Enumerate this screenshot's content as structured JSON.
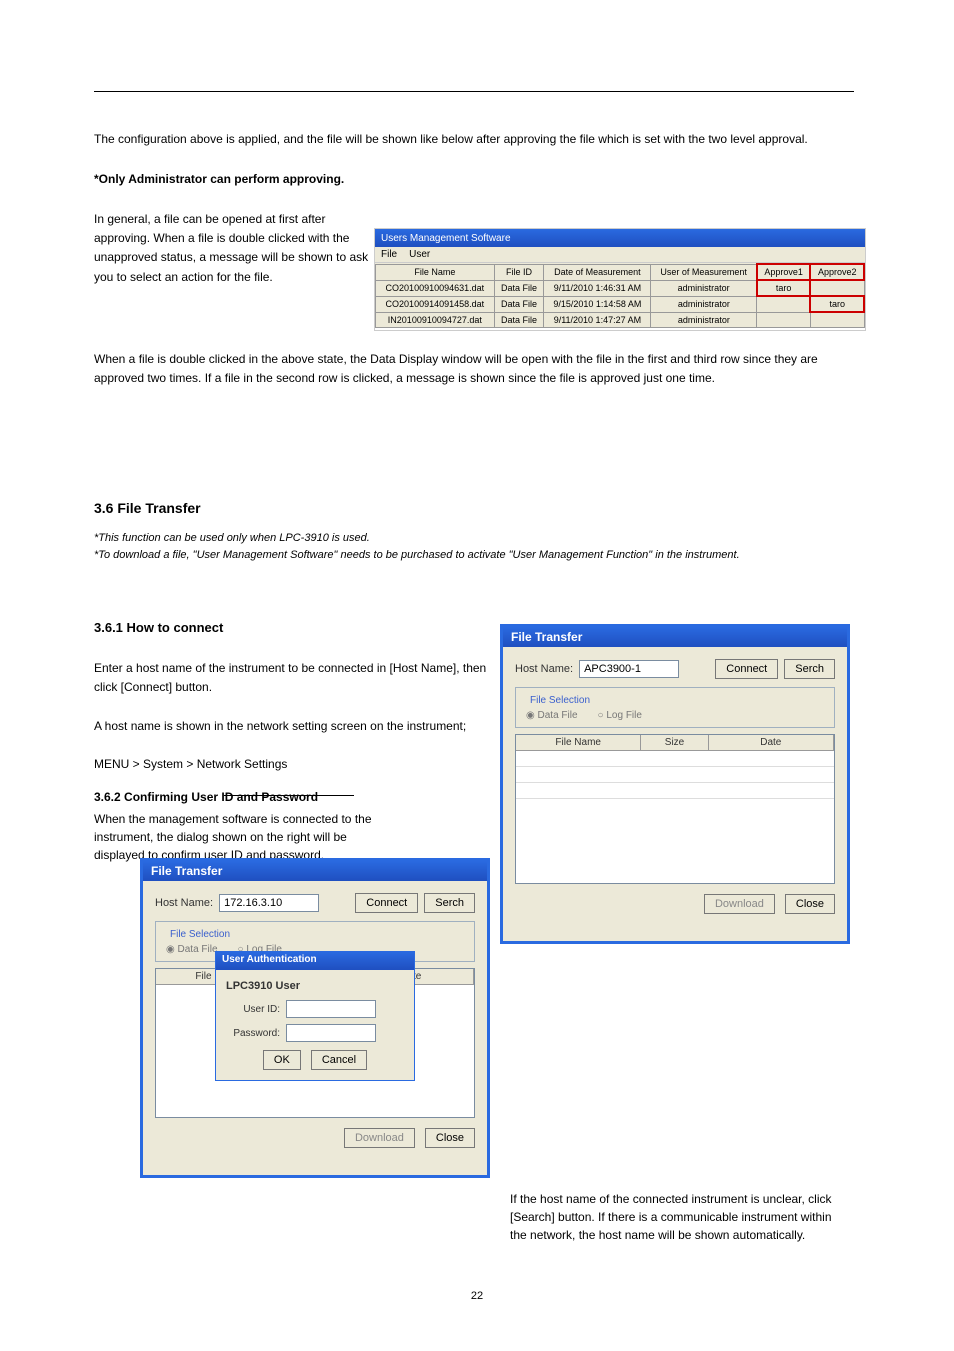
{
  "sectionText": {
    "intro": "The configuration above is applied, and the file will be shown like below after approving the file which is set with the two level approval.",
    "introBold": "*Only Administrator can perform approving.",
    "general": "In general, a file can be opened at first after approving. When a file is double clicked with the unapproved status, a message will be shown to ask you to select an action for the file.",
    "afterTable": "When a file is double clicked in the above state, the Data Display window will be open with the file in the first and third row since they are approved two times. If a file in the second row is clicked, a message is shown since the file is approved just one time.",
    "transferTitle": "3.6 File Transfer",
    "notes": "*This function can be used only when LPC-3910 is used.\n*To download a file, \"User Management Software\" needs to be purchased to activate \"User Management Function\" in the instrument.",
    "step1Title": "3.6.1 How to connect",
    "step1": "Enter a host name of the instrument to be connected in [Host Name], then click [Connect] button.\n\nA host name is shown in the network setting screen on the instrument;\n\nMENU > System > Network Settings",
    "authHead": "3.6.2 Confirming User ID and Password",
    "authDesc": "When the management software is connected to the instrument, the dialog shown on the right will be displayed to confirm user ID and password.",
    "searchDesc": "If the host name of the connected instrument is unclear, click [Search] button. If there is a communicable instrument within the network, the host name will be shown automatically."
  },
  "ums": {
    "title": "Users Management Software",
    "menu": {
      "file": "File",
      "user": "User"
    },
    "headers": {
      "fileName": "File Name",
      "fileId": "File ID",
      "date": "Date of Measurement",
      "userMeas": "User of Measurement",
      "approve1": "Approve1",
      "approve2": "Approve2"
    },
    "rows": [
      {
        "fileName": "CO20100910094631.dat",
        "fileId": "Data File",
        "date": "9/11/2010 1:46:31 AM",
        "user": "administrator",
        "a1": "taro",
        "a2": ""
      },
      {
        "fileName": "CO20100914091458.dat",
        "fileId": "Data File",
        "date": "9/15/2010 1:14:58 AM",
        "user": "administrator",
        "a1": "",
        "a2": "taro"
      },
      {
        "fileName": "IN20100910094727.dat",
        "fileId": "Data File",
        "date": "9/11/2010 1:47:27 AM",
        "user": "administrator",
        "a1": "",
        "a2": ""
      }
    ]
  },
  "ft": {
    "title": "File Transfer",
    "hostLabel": "Host Name:",
    "hostValue1": "APC3900-1",
    "hostValue2": "172.16.3.10",
    "connect": "Connect",
    "search": "Serch",
    "fileSelection": "File Selection",
    "dataFile": "Data File",
    "logFile": "Log File",
    "cols": {
      "name": "File Name",
      "size": "Size",
      "date": "Date"
    },
    "download": "Download",
    "close": "Close"
  },
  "auth": {
    "title": "User Authentication",
    "heading": "LPC3910 User",
    "userId": "User ID:",
    "password": "Password:",
    "ok": "OK",
    "cancel": "Cancel"
  },
  "footer": "22"
}
